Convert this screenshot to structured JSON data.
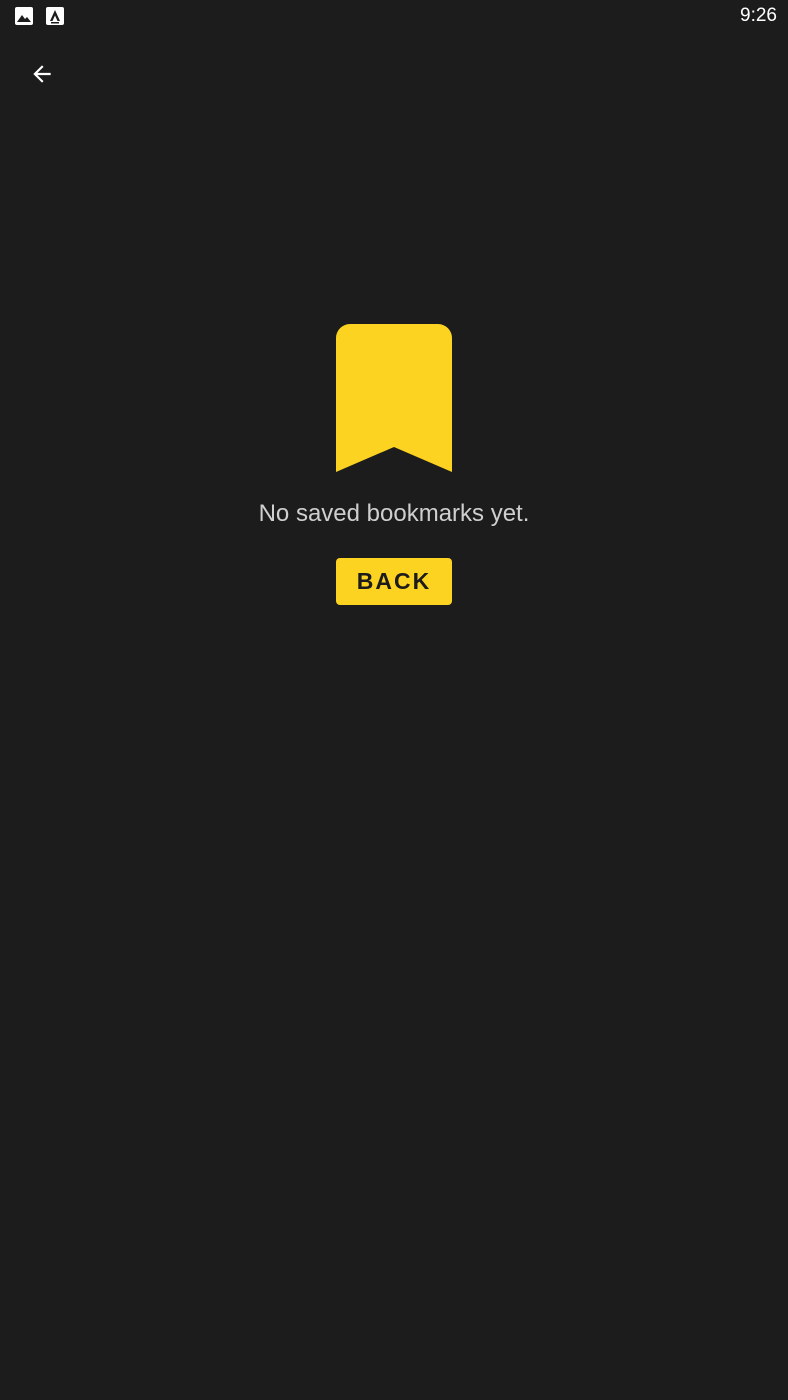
{
  "status_bar": {
    "time": "9:26",
    "icons": [
      "gallery-icon",
      "app-store-icon"
    ]
  },
  "toolbar": {
    "back_icon": "arrow-left-icon"
  },
  "empty_state": {
    "icon": "bookmark-icon",
    "message": "No saved bookmarks yet.",
    "button_label": "BACK"
  },
  "colors": {
    "background": "#1c1c1c",
    "accent": "#fdd321",
    "text_secondary": "#cfcfcf",
    "icon": "#ffffff"
  }
}
